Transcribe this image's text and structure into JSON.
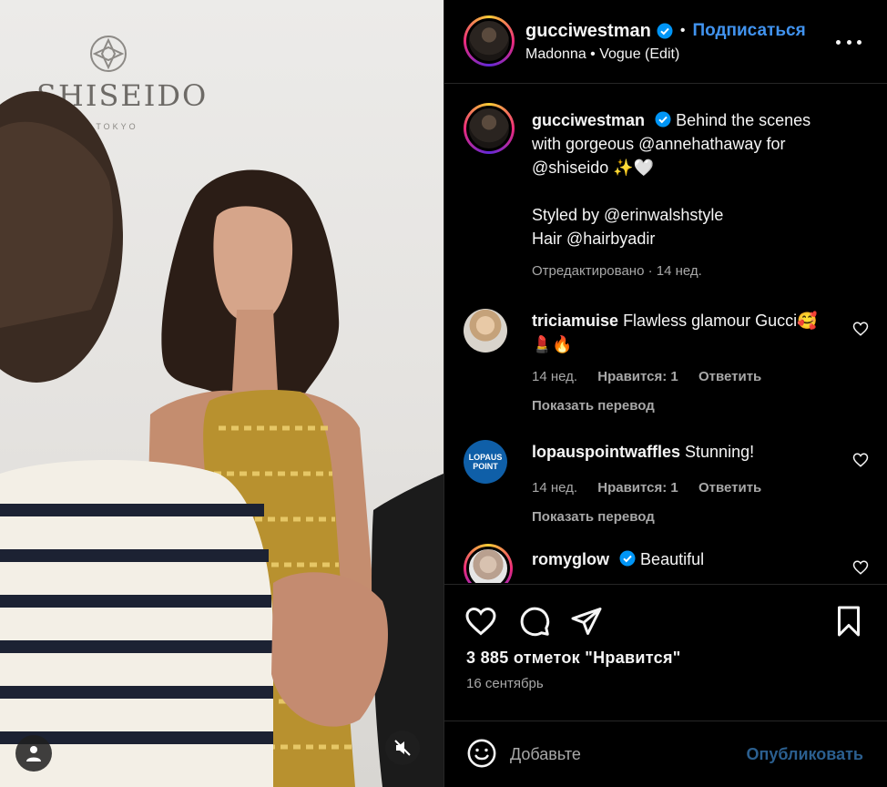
{
  "media": {
    "backdrop_brand": "SHISEIDO",
    "backdrop_sub": "GINZA TOKYO"
  },
  "post": {
    "author": "gucciwestman",
    "follow_label": "Подписаться",
    "separator": "•",
    "audio": "Madonna • Vogue (Edit)",
    "caption_lines": [
      "Behind the scenes",
      "with gorgeous @annehathaway for",
      "@shiseido ✨🤍",
      "",
      "Styled by @erinwalshstyle",
      "Hair @hairbyadir"
    ],
    "caption_meta": "Отредактировано · 14 нед.",
    "likes": "3 885 отметок \"Нравится\"",
    "date": "16 сентябрь"
  },
  "comments": [
    {
      "user": "triciamuise",
      "text": "Flawless glamour Gucci🥰💄🔥",
      "time": "14 нед.",
      "likes": "Нравится: 1",
      "reply": "Ответить",
      "translate": "Показать перевод"
    },
    {
      "user": "lopauspointwaffles",
      "text": "Stunning!",
      "time": "14 нед.",
      "likes": "Нравится: 1",
      "reply": "Ответить",
      "translate": "Показать перевод",
      "avatar_text": "LOPAUS POINT"
    },
    {
      "user": "romyglow",
      "text": "Beautiful",
      "verified": true
    }
  ],
  "add_comment": {
    "placeholder": "Добавьте",
    "publish_label": "Опубликовать"
  },
  "icons": {
    "like": "heart-icon",
    "comment": "comment-icon",
    "share": "send-icon",
    "save": "bookmark-icon",
    "emoji": "emoji-icon",
    "verified": "verified-badge-icon",
    "more": "more-icon",
    "mute": "mute-icon",
    "user": "user-icon"
  },
  "colors": {
    "background": "#000000",
    "link_blue": "#4193ef",
    "publish_disabled": "#2b5f8f",
    "muted_text": "#a8a8a8"
  }
}
